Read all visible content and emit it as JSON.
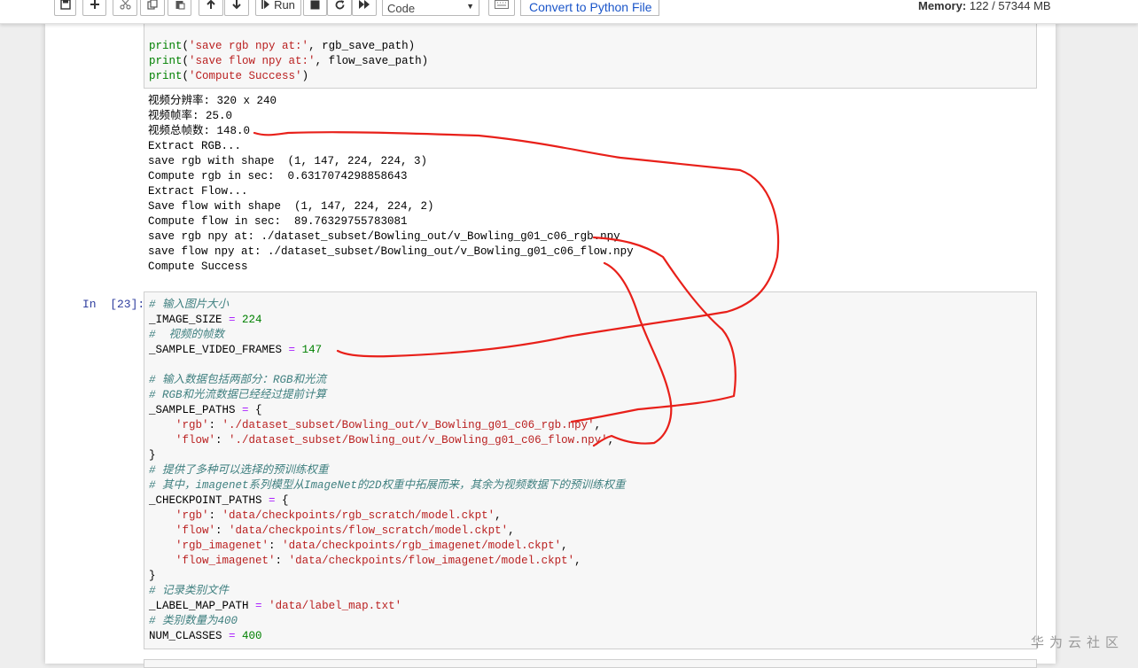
{
  "toolbar": {
    "run_label": "Run",
    "cell_type": "Code",
    "convert_label": "Convert to Python File",
    "memory_label": "Memory:",
    "memory_value": "122 / 57344 MB"
  },
  "cell_22": {
    "source_tail": [
      [
        [
          "kw",
          "print"
        ],
        [
          "t",
          "("
        ],
        [
          "st",
          "'save rgb npy at:'"
        ],
        [
          "t",
          ", rgb_save_path)"
        ]
      ],
      [
        [
          "kw",
          "print"
        ],
        [
          "t",
          "("
        ],
        [
          "st",
          "'save flow npy at:'"
        ],
        [
          "t",
          ", flow_save_path)"
        ]
      ],
      [
        [
          "kw",
          "print"
        ],
        [
          "t",
          "("
        ],
        [
          "st",
          "'Compute Success'"
        ],
        [
          "t",
          ")"
        ]
      ]
    ],
    "output": [
      "视频分辨率: 320 x 240",
      "视频帧率: 25.0",
      "视频总帧数: 148.0",
      "Extract RGB...",
      "save rgb with shape  (1, 147, 224, 224, 3)",
      "Compute rgb in sec:  0.6317074298858643",
      "Extract Flow...",
      "Save flow with shape  (1, 147, 224, 224, 2)",
      "Compute flow in sec:  89.76329755783081",
      "save rgb npy at: ./dataset_subset/Bowling_out/v_Bowling_g01_c06_rgb.npy",
      "save flow npy at: ./dataset_subset/Bowling_out/v_Bowling_g01_c06_flow.npy",
      "Compute Success"
    ]
  },
  "cell_23": {
    "prompt": "In  [23]:",
    "source": [
      [
        [
          "cm",
          "# 输入图片大小"
        ]
      ],
      [
        [
          "t",
          "_IMAGE_SIZE "
        ],
        [
          "op",
          "="
        ],
        [
          "t",
          " "
        ],
        [
          "nm",
          "224"
        ]
      ],
      [
        [
          "cm",
          "#  视频的帧数"
        ]
      ],
      [
        [
          "t",
          "_SAMPLE_VIDEO_FRAMES "
        ],
        [
          "op",
          "="
        ],
        [
          "t",
          " "
        ],
        [
          "nm",
          "147"
        ]
      ],
      [
        [
          "t",
          ""
        ]
      ],
      [
        [
          "cm",
          "# 输入数据包括两部分：RGB和光流"
        ]
      ],
      [
        [
          "cm",
          "# RGB和光流数据已经经过提前计算"
        ]
      ],
      [
        [
          "t",
          "_SAMPLE_PATHS "
        ],
        [
          "op",
          "="
        ],
        [
          "t",
          " {"
        ]
      ],
      [
        [
          "t",
          "    "
        ],
        [
          "st",
          "'rgb'"
        ],
        [
          "t",
          ": "
        ],
        [
          "st",
          "'./dataset_subset/Bowling_out/v_Bowling_g01_c06_rgb.npy'"
        ],
        [
          "t",
          ","
        ]
      ],
      [
        [
          "t",
          "    "
        ],
        [
          "st",
          "'flow'"
        ],
        [
          "t",
          ": "
        ],
        [
          "st",
          "'./dataset_subset/Bowling_out/v_Bowling_g01_c06_flow.npy'"
        ],
        [
          "t",
          ","
        ]
      ],
      [
        [
          "t",
          "}"
        ]
      ],
      [
        [
          "cm",
          "# 提供了多种可以选择的预训练权重"
        ]
      ],
      [
        [
          "cm",
          "# 其中，imagenet系列模型从ImageNet的2D权重中拓展而来，其余为视频数据下的预训练权重"
        ]
      ],
      [
        [
          "t",
          "_CHECKPOINT_PATHS "
        ],
        [
          "op",
          "="
        ],
        [
          "t",
          " {"
        ]
      ],
      [
        [
          "t",
          "    "
        ],
        [
          "st",
          "'rgb'"
        ],
        [
          "t",
          ": "
        ],
        [
          "st",
          "'data/checkpoints/rgb_scratch/model.ckpt'"
        ],
        [
          "t",
          ","
        ]
      ],
      [
        [
          "t",
          "    "
        ],
        [
          "st",
          "'flow'"
        ],
        [
          "t",
          ": "
        ],
        [
          "st",
          "'data/checkpoints/flow_scratch/model.ckpt'"
        ],
        [
          "t",
          ","
        ]
      ],
      [
        [
          "t",
          "    "
        ],
        [
          "st",
          "'rgb_imagenet'"
        ],
        [
          "t",
          ": "
        ],
        [
          "st",
          "'data/checkpoints/rgb_imagenet/model.ckpt'"
        ],
        [
          "t",
          ","
        ]
      ],
      [
        [
          "t",
          "    "
        ],
        [
          "st",
          "'flow_imagenet'"
        ],
        [
          "t",
          ": "
        ],
        [
          "st",
          "'data/checkpoints/flow_imagenet/model.ckpt'"
        ],
        [
          "t",
          ","
        ]
      ],
      [
        [
          "t",
          "}"
        ]
      ],
      [
        [
          "cm",
          "# 记录类别文件"
        ]
      ],
      [
        [
          "t",
          "_LABEL_MAP_PATH "
        ],
        [
          "op",
          "="
        ],
        [
          "t",
          " "
        ],
        [
          "st",
          "'data/label_map.txt'"
        ]
      ],
      [
        [
          "cm",
          "# 类别数量为400"
        ]
      ],
      [
        [
          "t",
          "NUM_CLASSES "
        ],
        [
          "op",
          "="
        ],
        [
          "t",
          " "
        ],
        [
          "nm",
          "400"
        ]
      ]
    ]
  },
  "watermark": "华为云社区",
  "colors": {
    "annotation": "#e8201a",
    "prompt": "#303f9f",
    "comment": "#408080",
    "string": "#ba2121",
    "keyword": "#008000"
  }
}
